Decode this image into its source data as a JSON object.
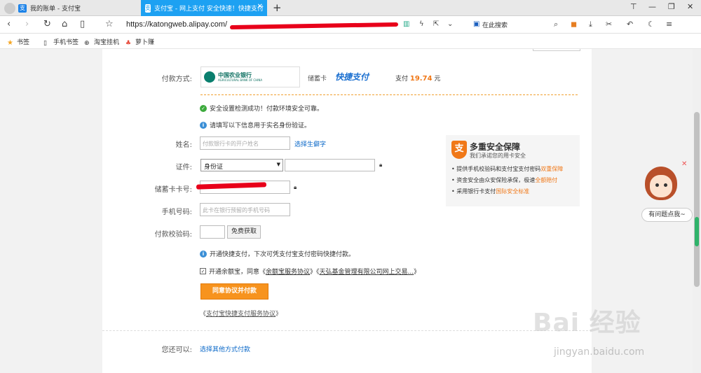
{
  "browser": {
    "tabs": [
      {
        "title": "我的账单 - 支付宝",
        "active": false
      },
      {
        "title": "支付宝 - 网上支付 安全快速！快捷支付",
        "active": true
      }
    ],
    "url": "https://katongweb.alipay.com/",
    "search_placeholder": "在此搜索",
    "bookmarks": [
      "书签",
      "手机书签",
      "淘宝挂机",
      "萝卜赚"
    ]
  },
  "payment": {
    "method_label": "付款方式:",
    "bank_name": "中国农业银行",
    "bank_name_en": "AGRICULTURAL BANK OF CHINA",
    "card_type": "储蓄卡",
    "quick_pay": "快捷支付",
    "pay_prefix": "支付",
    "amount": "19.74",
    "currency": "元"
  },
  "messages": {
    "security_ok": "安全设置检测成功！付款环境安全可靠。",
    "fill_info": "请填写以下信息用于实名身份验证。",
    "enable_quick": "开通快捷支付，下次可凭支付宝支付密码快捷付款。"
  },
  "form": {
    "name_label": "姓名:",
    "name_placeholder": "付款银行卡的开户姓名",
    "rare_char_link": "选择生僻字",
    "id_label": "证件:",
    "id_type": "身份证",
    "card_label": "储蓄卡卡号:",
    "phone_label": "手机号码:",
    "phone_placeholder": "此卡在银行预留的手机号码",
    "code_label": "付款校验码:",
    "get_code_button": "免费获取",
    "yuebao_prefix": "开通余额宝，同意《",
    "yuebao_link1": "余额宝服务协议",
    "yuebao_mid": "》《",
    "yuebao_link2": "天弘基金管理有限公司网上交易...",
    "yuebao_suffix": "》",
    "agree_button": "同意协议并付款",
    "agreement_prefix": "《",
    "agreement_link": "支付宝快捷支付服务协议",
    "agreement_suffix": "》",
    "other_label": "您还可以:",
    "other_link": "选择其他方式付款"
  },
  "security": {
    "title": "多重安全保障",
    "subtitle": "我们承诺您的用卡安全",
    "items": [
      {
        "text": "提供手机校验码和支付宝支付密码",
        "highlight": "双重保障"
      },
      {
        "text": "资金安全由众安保险承保，极速",
        "highlight": "全额赔付"
      },
      {
        "text": "采用银行卡支付",
        "highlight": "国际安全标准"
      }
    ]
  },
  "assistant": {
    "bubble": "有问题点我~"
  },
  "watermark": {
    "main": "Bai 经验",
    "sub": "jingyan.baidu.com"
  }
}
